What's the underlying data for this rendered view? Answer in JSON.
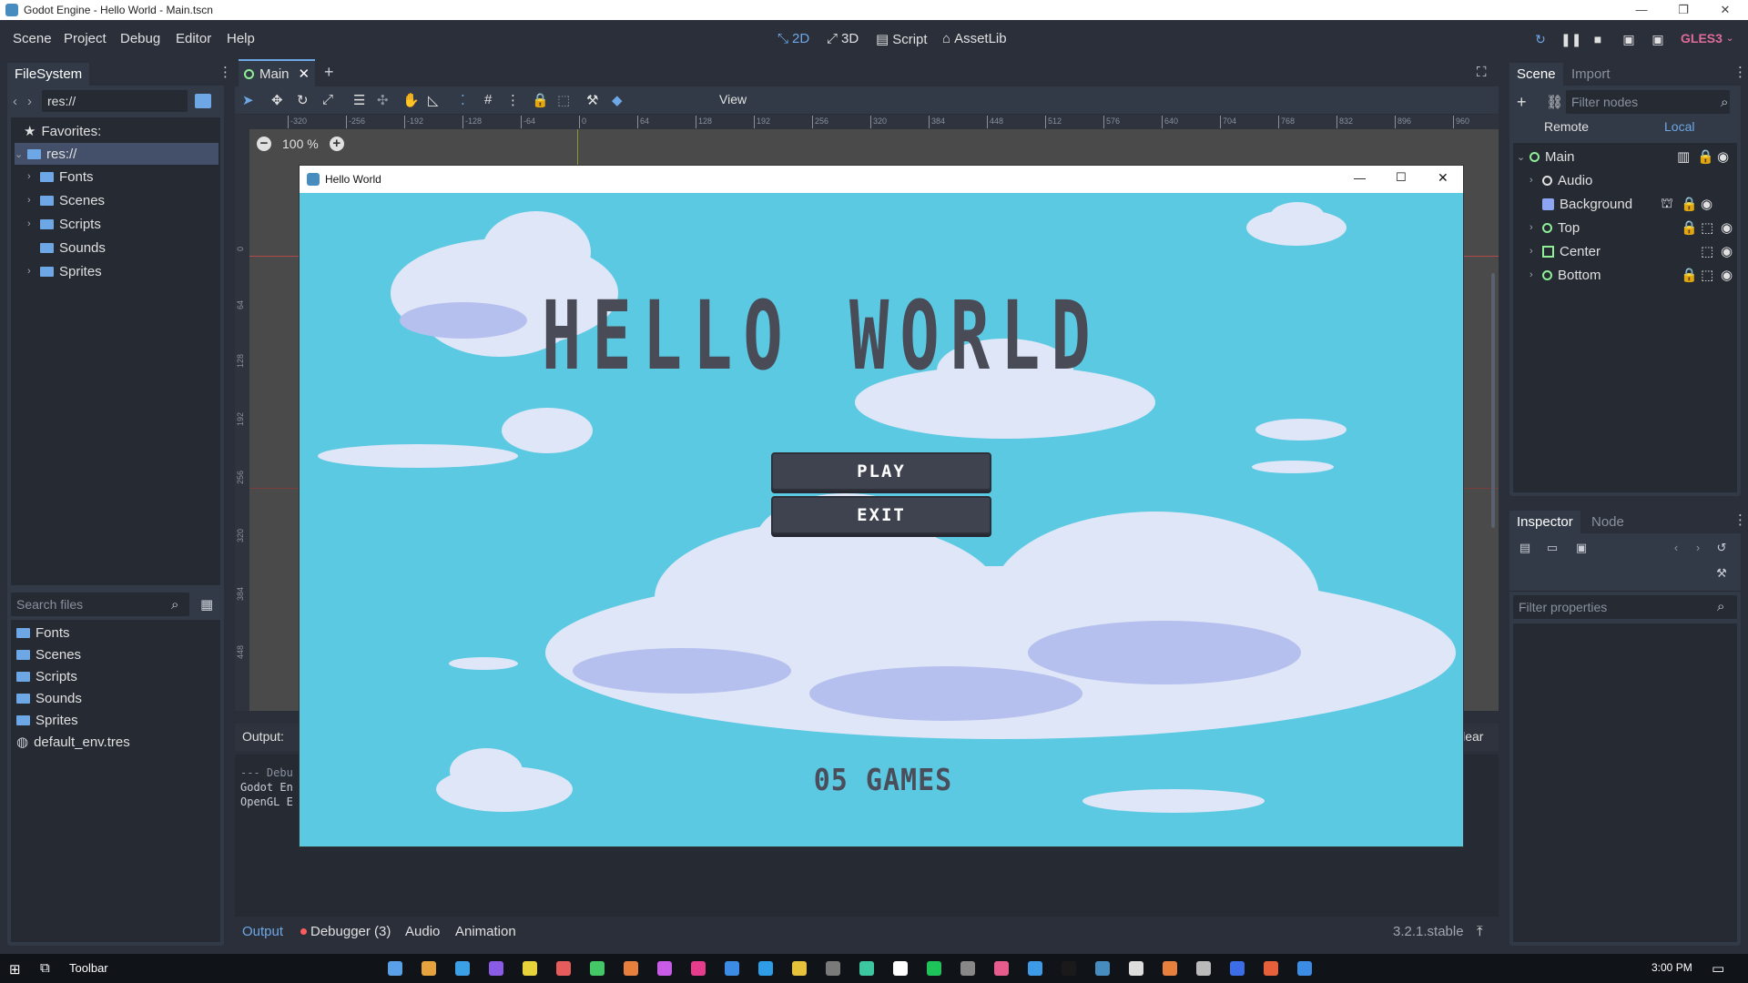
{
  "window": {
    "title": "Godot Engine - Hello World - Main.tscn"
  },
  "menus": [
    "Scene",
    "Project",
    "Debug",
    "Editor",
    "Help"
  ],
  "modes": [
    {
      "label": "2D",
      "icon": "2d-icon",
      "active": true
    },
    {
      "label": "3D",
      "icon": "3d-icon",
      "active": false
    },
    {
      "label": "Script",
      "icon": "script-icon",
      "active": false
    },
    {
      "label": "AssetLib",
      "icon": "assetlib-icon",
      "active": false
    }
  ],
  "renderer": "GLES3",
  "accent_color": "#6ea7e5",
  "filesystem": {
    "tab": "FileSystem",
    "path": "res://",
    "favorites_label": "Favorites:",
    "tree": [
      "res://",
      "Fonts",
      "Scenes",
      "Scripts",
      "Sounds",
      "Sprites"
    ],
    "search_placeholder": "Search files",
    "files": [
      "Fonts",
      "Scenes",
      "Scripts",
      "Sounds",
      "Sprites",
      "default_env.tres"
    ]
  },
  "editor_tabs": {
    "main_tab": "Main"
  },
  "toolbar": {
    "view": "View"
  },
  "zoom": "100 %",
  "ruler_ticks": [
    "-320",
    "-256",
    "-192",
    "-128",
    "-64",
    "0",
    "64",
    "128",
    "192",
    "256",
    "320",
    "384",
    "448",
    "512",
    "576",
    "640",
    "704",
    "768",
    "832",
    "896",
    "960"
  ],
  "vruler_ticks": [
    "0",
    "64",
    "128",
    "192",
    "256",
    "320",
    "384",
    "448"
  ],
  "scene_dock": {
    "tabs": [
      "Scene",
      "Import"
    ],
    "filter_placeholder": "Filter nodes",
    "remote": "Remote",
    "local": "Local",
    "nodes": [
      "Main",
      "Audio",
      "Background",
      "Top",
      "Center",
      "Bottom"
    ]
  },
  "inspector": {
    "tabs": [
      "Inspector",
      "Node"
    ],
    "filter_placeholder": "Filter properties"
  },
  "output": {
    "label": "Output:",
    "clear": "Clear",
    "lines": [
      "--- Debu",
      "Godot En",
      "OpenGL E"
    ]
  },
  "bottom_tabs": [
    "Output",
    "Debugger (3)",
    "Audio",
    "Animation"
  ],
  "version": "3.2.1.stable",
  "game": {
    "title": "Hello World",
    "heading_1": "HELLO",
    "heading_2": "WORLD",
    "play": "PLAY",
    "exit": "EXIT",
    "credit": "05 GAMES",
    "sky_color": "#5cc9e2"
  },
  "taskbar": {
    "toolbar": "Toolbar",
    "time": "3:00 PM"
  }
}
